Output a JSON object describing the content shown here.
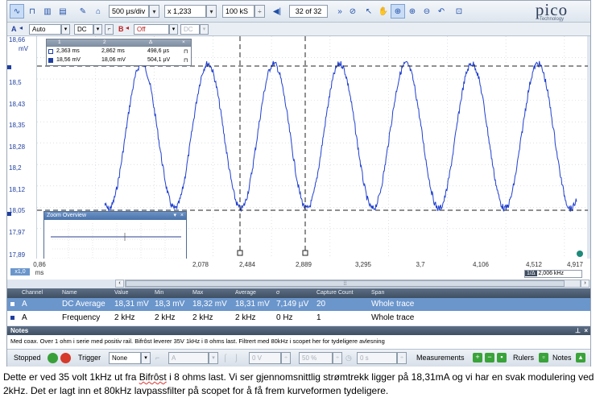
{
  "toolbar": {
    "timebase": "500 µs/div",
    "zoom": "x 1,233",
    "samples": "100 kS",
    "buffer": "32 of 32",
    "logo": "pico",
    "logo_sub": "Technology"
  },
  "channels": {
    "a_label": "A",
    "a_coupling": "Auto",
    "a_dc": "DC",
    "b_label": "B",
    "b_range": "Off",
    "b_dc": "DC"
  },
  "yaxis": {
    "unit": "mV",
    "ticks": [
      "18,66",
      "18,5",
      "18,43",
      "18,35",
      "18,28",
      "18,2",
      "18,12",
      "18,05",
      "17,97",
      "17,89"
    ]
  },
  "xaxis": {
    "unit": "ms",
    "start": "0,86",
    "scale": "x1,0",
    "ticks": [
      "2,078",
      "2,484",
      "2,889",
      "3,295",
      "3,7",
      "4,106",
      "4,512",
      "4,917"
    ],
    "freq_readout": "2,006 kHz",
    "freq_prefix": "1/Δ"
  },
  "rulers": {
    "headers": [
      "1",
      "2",
      "Δ"
    ],
    "time": [
      "2,363 ms",
      "2,862 ms",
      "498,6 µs"
    ],
    "volt": [
      "18,56 mV",
      "18,06 mV",
      "504,1 µV"
    ]
  },
  "zoom_overview": {
    "title": "Zoom Overview"
  },
  "measurements": {
    "headers": [
      "Channel",
      "Name",
      "Value",
      "Min",
      "Max",
      "Average",
      "σ",
      "Capture Count",
      "Span"
    ],
    "rows": [
      [
        "A",
        "DC Average",
        "18,31 mV",
        "18,3 mV",
        "18,32 mV",
        "18,31 mV",
        "7,149 µV",
        "20",
        "Whole trace"
      ],
      [
        "A",
        "Frequency",
        "2 kHz",
        "2 kHz",
        "2 kHz",
        "2 kHz",
        "0 Hz",
        "1",
        "Whole trace"
      ]
    ]
  },
  "notes": {
    "title": "Notes",
    "text": "Med coax. Over 1 ohm i serie med positiv rail. Bifrôst leverer 35V 1kHz i 8 ohms last. Filtrert med 80kHz i scopet her for tydeligere avlesning"
  },
  "status": {
    "state": "Stopped",
    "trigger_label": "Trigger",
    "trigger_mode": "None",
    "trigger_channel": "A",
    "trigger_level": "0 V",
    "pretrigger": "50 %",
    "delay": "0 s",
    "measurements_label": "Measurements",
    "rulers_label": "Rulers",
    "notes_label": "Notes"
  },
  "caption": {
    "part1": "Dette er ved 35 volt 1kHz ut fra ",
    "brand": "Bifrôst",
    "part2": " i 8 ohms last. Vi ser gjennomsnittlig strømtrekk ligger på 18,31mA og vi har en svak modulering ved 2kHz. Det er lagt inn et 80kHz lavpassfilter på scopet for å få frem kurveformen tydeligere."
  },
  "colors": {
    "trace": "#1f3fd0",
    "accent": "#6b96cc"
  }
}
